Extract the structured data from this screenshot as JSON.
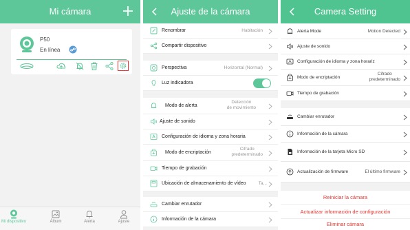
{
  "screen1": {
    "title": "Mi cámara",
    "camera": {
      "name": "P50",
      "status": "En línea"
    },
    "tabs": [
      {
        "label": "Mi dispositivo",
        "icon": "camera-icon",
        "active": true
      },
      {
        "label": "Álbum",
        "icon": "album-icon",
        "active": false
      },
      {
        "label": "Alerta",
        "icon": "bell-icon",
        "active": false
      },
      {
        "label": "Ajuste",
        "icon": "person-icon",
        "active": false
      }
    ],
    "accent": "#5ec79a",
    "highlight": "#e33333"
  },
  "screen2": {
    "title": "Ajuste de la cámara",
    "rows": {
      "rename": {
        "label": "Renombrar",
        "value": "Habitación"
      },
      "share": {
        "label": "Compartir dispositivo"
      },
      "perspective": {
        "label": "Perspectiva",
        "value": "Horizontal (Normal)"
      },
      "light": {
        "label": "Luz indicadora",
        "toggle_on": true
      },
      "alert_mode": {
        "label": "Modo de alerta",
        "value1": "Detección",
        "value2": "de movimiento"
      },
      "sound": {
        "label": "Ajuste de sonido"
      },
      "language": {
        "label": "Configuración de idioma y zona horaria"
      },
      "encryption": {
        "label": "Modo de encriptación",
        "value1": "Cifrado",
        "value2": "predeterminado"
      },
      "record_time": {
        "label": "Tiempo de grabación"
      },
      "storage": {
        "label": "Ubicación de almacenamiento de vídeo",
        "value": "Ta..."
      },
      "router": {
        "label": "Cambiar enrutador"
      },
      "camera_info": {
        "label": "Información de la cámara"
      }
    }
  },
  "screen3": {
    "title": "Camera Setting",
    "rows": {
      "alert_mode": {
        "label": "Alerta Mode",
        "value": "Motion Detected"
      },
      "sound": {
        "label": "Ajuste de sonido"
      },
      "language": {
        "label": "Configuración de idioma y zona horariz"
      },
      "encryption": {
        "label": "Modo de encriptación",
        "value1": "Cifrado",
        "value2": "predeterminado"
      },
      "record_time": {
        "label": "Tiempo de grabación"
      },
      "router": {
        "label": "Cambiar enrutador"
      },
      "camera_info": {
        "label": "Información de la cámara"
      },
      "sd_info": {
        "label": "Información de la tarjeta Micro SD"
      },
      "firmware": {
        "label": "Actualización de firmware",
        "value": "El último firmware"
      }
    },
    "actions": {
      "restart": "Reiniciar la cámara",
      "update_config": "Actualizar información de configuración",
      "delete": "Eliminar cámara"
    }
  }
}
